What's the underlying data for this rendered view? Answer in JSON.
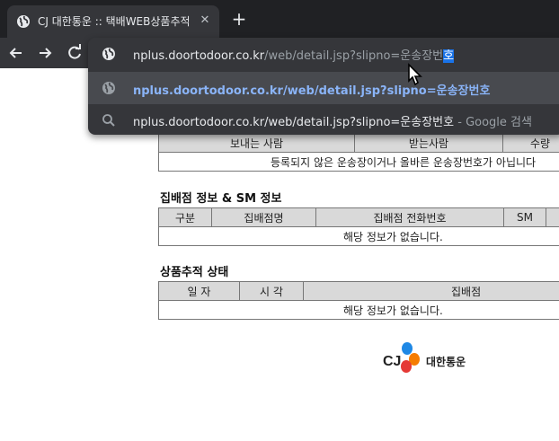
{
  "browser": {
    "tab": {
      "title": "CJ 대한통운 :: 택배WEB상품추적",
      "close_icon": "close-icon"
    },
    "newtab_label": "+",
    "address": {
      "host": "nplus.doortodoor.co.kr",
      "path": "/web/detail.jsp?slipno=운송장번",
      "selected": "호"
    },
    "suggestions": [
      {
        "icon": "globe-icon",
        "text": "nplus.doortodoor.co.kr/web/detail.jsp?slipno=운송장번호",
        "suffix": ""
      },
      {
        "icon": "search-icon",
        "text": "nplus.doortodoor.co.kr/web/detail.jsp?slipno=운송장번호",
        "suffix": " - Google 검색"
      }
    ]
  },
  "page": {
    "sender_table": {
      "headers": [
        "보내는 사람",
        "받는사람",
        "수량"
      ],
      "message": "등록되지 않은 운송장이거나 올바른 운송장번호가 아닙니다"
    },
    "branch_section": {
      "title": "집배점 정보 & SM 정보",
      "headers": [
        "구분",
        "집배점명",
        "집배점 전화번호",
        "SM",
        ""
      ],
      "empty": "해당 정보가 없습니다."
    },
    "tracking_section": {
      "title": "상품추적 상태",
      "headers": [
        "일 자",
        "시 각",
        "집배점"
      ],
      "empty": "해당 정보가 없습니다."
    },
    "logo": {
      "text": "대한통운",
      "colors": {
        "blue": "#1e88e5",
        "orange": "#f57c00",
        "red": "#e53935"
      }
    }
  }
}
